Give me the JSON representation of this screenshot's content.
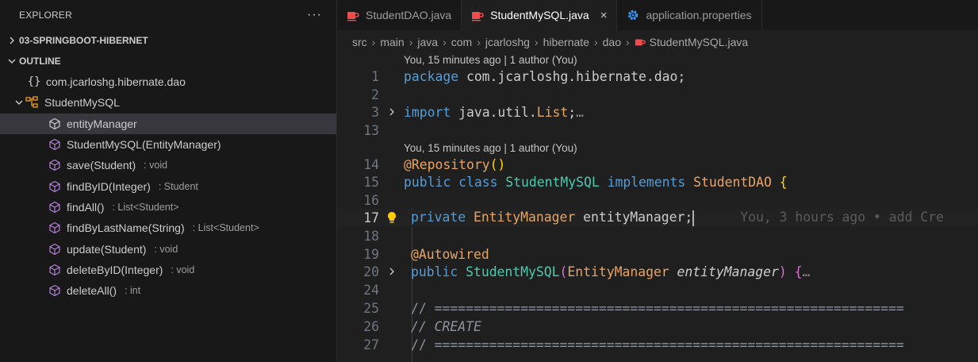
{
  "sidebar": {
    "title": "EXPLORER",
    "more_label": "···",
    "sections": [
      {
        "label": "03-SPRINGBOOT-HIBERNET",
        "expanded": false
      },
      {
        "label": "OUTLINE",
        "expanded": true
      }
    ],
    "outline": {
      "namespace": {
        "icon_text": "{}",
        "label": "com.jcarloshg.hibernate.dao"
      },
      "class": {
        "label": "StudentMySQL"
      },
      "members": [
        {
          "label": "entityManager",
          "detail": "",
          "icon": "field-icon"
        },
        {
          "label": "StudentMySQL(EntityManager)",
          "detail": "",
          "icon": "method-icon"
        },
        {
          "label": "save(Student)",
          "detail": ": void",
          "icon": "method-icon"
        },
        {
          "label": "findByID(Integer)",
          "detail": ": Student",
          "icon": "method-icon"
        },
        {
          "label": "findAll()",
          "detail": ": List<Student>",
          "icon": "method-icon"
        },
        {
          "label": "findByLastName(String)",
          "detail": ": List<Student>",
          "icon": "method-icon"
        },
        {
          "label": "update(Student)",
          "detail": ": void",
          "icon": "method-icon"
        },
        {
          "label": "deleteByID(Integer)",
          "detail": ": void",
          "icon": "method-icon"
        },
        {
          "label": "deleteAll()",
          "detail": ": int",
          "icon": "method-icon"
        }
      ]
    }
  },
  "tabs": [
    {
      "label": "StudentDAO.java",
      "icon": "java-icon",
      "active": false
    },
    {
      "label": "StudentMySQL.java",
      "icon": "java-icon",
      "active": true,
      "close": "×"
    },
    {
      "label": "application.properties",
      "icon": "gear-icon",
      "active": false
    }
  ],
  "breadcrumb": [
    "src",
    "main",
    "java",
    "com",
    "jcarloshg",
    "hibernate",
    "dao",
    "StudentMySQL.java"
  ],
  "breadcrumb_sep": "›",
  "codelens": [
    "You, 15 minutes ago | 1 author (You)",
    "You, 15 minutes ago | 1 author (You)"
  ],
  "code": {
    "line_numbers": [
      "1",
      "2",
      "3",
      "13",
      "14",
      "15",
      "16",
      "17",
      "18",
      "19",
      "20",
      "24",
      "25",
      "26",
      "27"
    ],
    "l1": {
      "kw": "package",
      "rest": " com.jcarloshg.hibernate.dao;"
    },
    "l3": {
      "kw": "import",
      "pkg": " java.util.",
      "type": "List",
      "semi": ";",
      "fold": "…"
    },
    "l14": {
      "at": "@",
      "ann": "Repository",
      "parens": "()"
    },
    "l15": {
      "kw1": "public",
      "kw2": " class ",
      "cls": "StudentMySQL",
      "kw3": " implements ",
      "iface": "StudentDAO",
      "brace": " {"
    },
    "l17": {
      "kw": "private",
      "type": " EntityManager",
      "var": " entityManager;",
      "blame": "You, 3 hours ago • add Cre"
    },
    "l19": {
      "at": "@",
      "ann": "Autowired"
    },
    "l20": {
      "kw": "public",
      "name": " StudentMySQL",
      "open": "(",
      "type": "EntityManager",
      "param": " entityManager",
      "close": ")",
      "brace": " {",
      "fold": "…"
    },
    "l25": "// ============================================================",
    "l26": "// CREATE",
    "l27": "// ============================================================"
  },
  "colors": {
    "keyword": "#569cd6",
    "type": "#4ec9b0",
    "annotation_type": "#e8a463",
    "comment": "#8b949e",
    "member_icon": "#b180d7",
    "class_icon": "#ee9d28",
    "java_icon": "#f14c4c",
    "gear_icon": "#3794ff"
  }
}
